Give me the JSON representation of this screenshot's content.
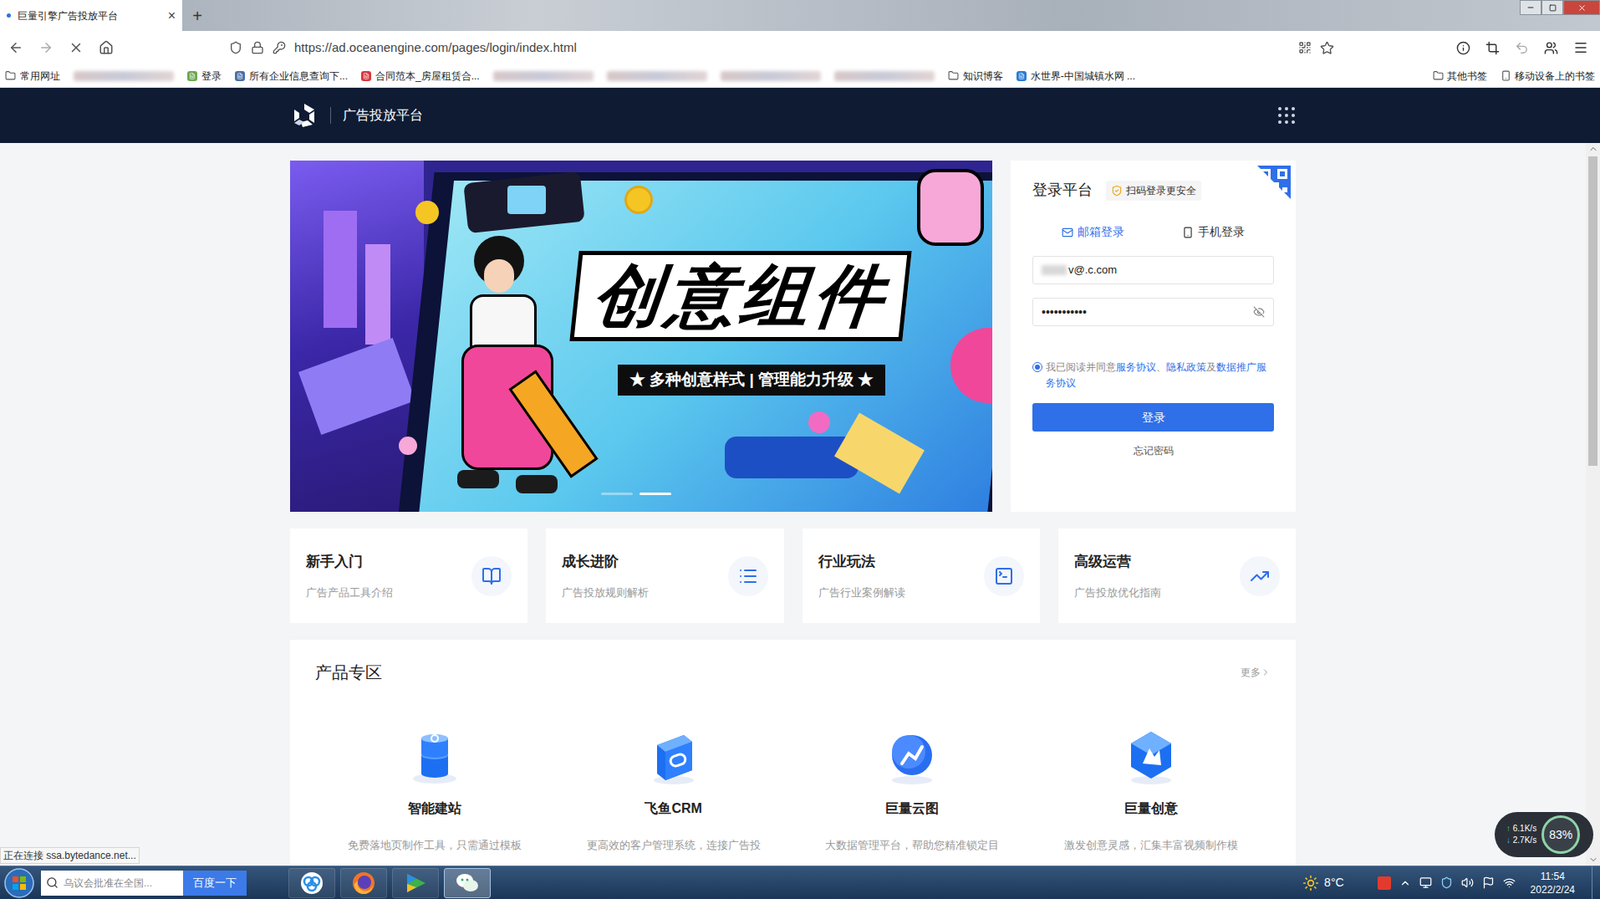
{
  "browser": {
    "tab": {
      "title": "巨量引擎广告投放平台",
      "close": "×",
      "loading": true,
      "selected": true
    },
    "new_tab": "+",
    "url": "https://ad.oceanengine.com/pages/login/index.html",
    "bookmarks": [
      {
        "kind": "folder",
        "label": "常用网址"
      },
      {
        "kind": "blurred"
      },
      {
        "kind": "link",
        "label": "登录",
        "color": "#6aa84f"
      },
      {
        "kind": "link",
        "label": "所有企业信息查询下...",
        "color": "#4a6fa5"
      },
      {
        "kind": "link",
        "label": "合同范本_房屋租赁合...",
        "color": "#d9363e"
      },
      {
        "kind": "blurred"
      },
      {
        "kind": "blurred"
      },
      {
        "kind": "blurred"
      },
      {
        "kind": "blurred"
      },
      {
        "kind": "folder",
        "label": "知识博客"
      },
      {
        "kind": "link",
        "label": "水世界-中国城镇水网 ...",
        "color": "#2a7bd3"
      }
    ],
    "bookmarks_right": [
      {
        "kind": "folder",
        "label": "其他书签"
      },
      {
        "kind": "mobile",
        "label": "移动设备上的书签"
      }
    ],
    "status": "正在连接 ssa.bytedance.net..."
  },
  "header": {
    "title": "广告投放平台"
  },
  "banner": {
    "headline": "创意组件",
    "tagline": "★ 多种创意样式 | 管理能力升级 ★",
    "slides": [
      {
        "selected": false
      },
      {
        "selected": true
      }
    ]
  },
  "login": {
    "title": "登录平台",
    "badge": "扫码登录更安全",
    "tabs": [
      {
        "label": "邮箱登录",
        "kind": "mail",
        "selected": true
      },
      {
        "label": "手机登录",
        "kind": "phone",
        "selected": false
      }
    ],
    "email": "v@.c.com",
    "password": "•••••••••••",
    "agreement": {
      "checked": true,
      "parts": [
        {
          "text": "我已阅读并同意",
          "link": false
        },
        {
          "text": "服务协议",
          "link": true
        },
        {
          "text": "、",
          "link": false
        },
        {
          "text": "隐私政策",
          "link": true
        },
        {
          "text": "及",
          "link": false
        },
        {
          "text": "数据推广服务协议",
          "link": true
        }
      ]
    },
    "button": "登录",
    "forgot": "忘记密码"
  },
  "guides": [
    {
      "title": "新手入门",
      "subtitle": "广告产品工具介绍",
      "kind": "book"
    },
    {
      "title": "成长进阶",
      "subtitle": "广告投放规则解析",
      "kind": "list"
    },
    {
      "title": "行业玩法",
      "subtitle": "广告行业案例解读",
      "kind": "terminal"
    },
    {
      "title": "高级运营",
      "subtitle": "广告投放优化指南",
      "kind": "chart"
    }
  ],
  "products": {
    "title": "产品专区",
    "more": "更多",
    "items": [
      {
        "name": "智能建站",
        "desc": "免费落地页制作工具，只需通过模板",
        "kind": "stack"
      },
      {
        "name": "飞鱼CRM",
        "desc": "更高效的客户管理系统，连接广告投",
        "kind": "tile"
      },
      {
        "name": "巨量云图",
        "desc": "大数据管理平台，帮助您精准锁定目",
        "kind": "orb"
      },
      {
        "name": "巨量创意",
        "desc": "激发创意灵感，汇集丰富视频制作模",
        "kind": "hex"
      }
    ]
  },
  "net_widget": {
    "up": "6.1K/s",
    "down": "2.7K/s",
    "percent": "83%"
  },
  "taskbar": {
    "search": {
      "placeholder": "乌议会批准在全国...",
      "button": "百度一下"
    },
    "apps": [
      {
        "kind": "cloud",
        "active": false
      },
      {
        "kind": "firefox",
        "active": false
      },
      {
        "kind": "player",
        "active": false
      },
      {
        "kind": "wechat",
        "active": true
      }
    ],
    "weather": "8°C",
    "time": "11:54",
    "date": "2022/2/24"
  }
}
